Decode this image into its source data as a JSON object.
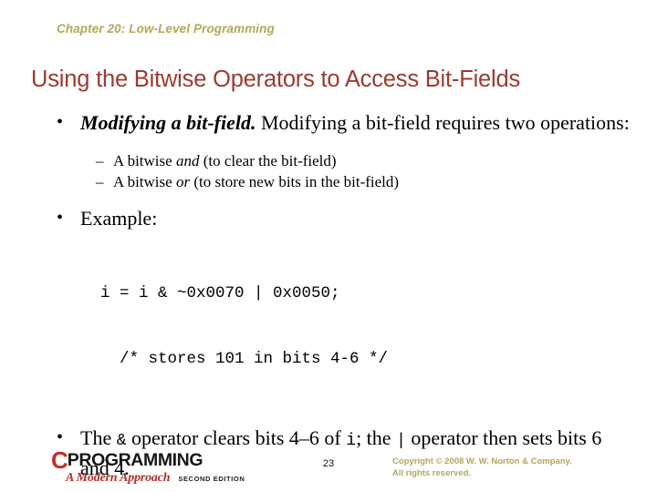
{
  "slide": {
    "chapter_header": "Chapter 20: Low-Level Programming",
    "title": "Using the Bitwise Operators to Access Bit-Fields",
    "colors": {
      "chapter_header": "#b3a75a",
      "title": "#9c3a32",
      "body_text": "#000000",
      "logo_red": "#c2302a",
      "copyright": "#b3a75a",
      "background": "#ffffff"
    }
  },
  "content": {
    "bullet1": {
      "marker": "•",
      "lead_bold_italic": "Modifying a bit-field.",
      "rest": " Modifying a bit-field requires two operations:"
    },
    "subbullets": [
      {
        "marker": "–",
        "before": "A bitwise ",
        "italic": "and",
        "after": " (to clear the bit-field)"
      },
      {
        "marker": "–",
        "before": "A bitwise ",
        "italic": "or",
        "after": " (to store new bits in the bit-field)"
      }
    ],
    "bullet2": {
      "marker": "•",
      "text": "Example:"
    },
    "code": {
      "line1": "i = i & ~0x0070 | 0x0050;",
      "line2": "  /* stores 101 in bits 4-6 */"
    },
    "bullet3": {
      "marker": "•",
      "seg1": "The ",
      "code1": "&",
      "seg2": " operator clears bits 4–6 of ",
      "code2": "i",
      "seg3": "; the ",
      "code3": "|",
      "seg4": " operator then sets bits 6 and 4."
    }
  },
  "footer": {
    "logo": {
      "c_letter": "C",
      "word": "PROGRAMMING",
      "subtitle": "A Modern Approach",
      "edition": "Second Edition"
    },
    "page_number": "23",
    "copyright_line1": "Copyright © 2008 W. W. Norton & Company.",
    "copyright_line2": "All rights reserved."
  }
}
